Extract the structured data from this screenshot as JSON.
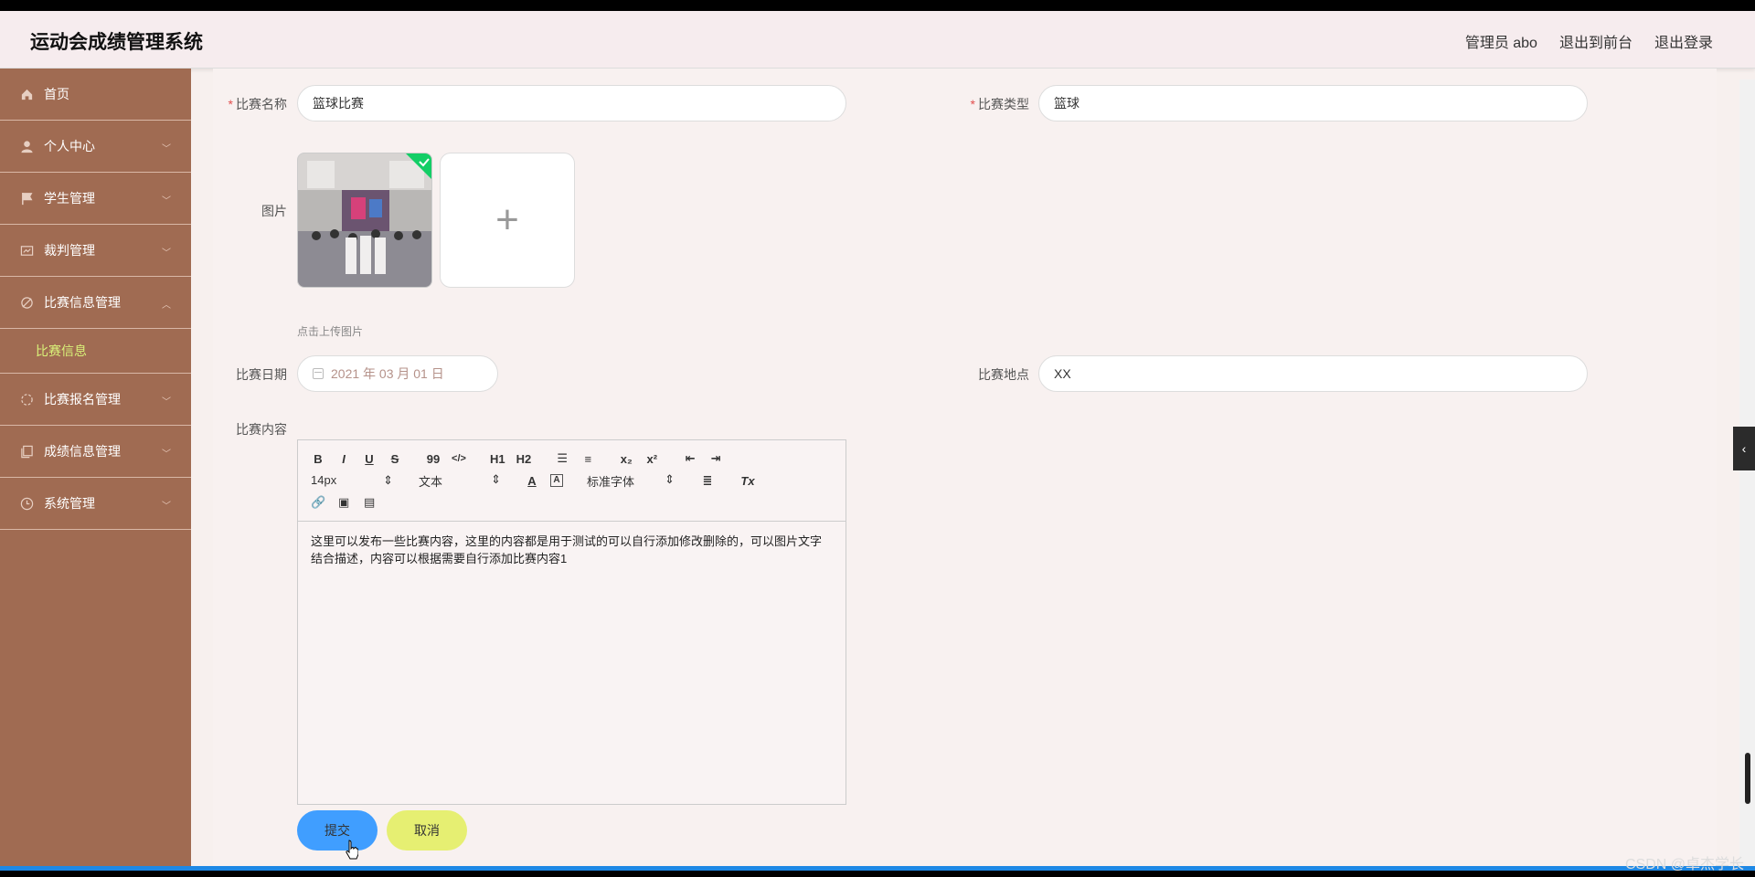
{
  "header": {
    "title": "运动会成绩管理系统",
    "admin": "管理员 abo",
    "exit_front": "退出到前台",
    "logout": "退出登录"
  },
  "sidebar": {
    "items": [
      {
        "label": "首页",
        "icon": "home-icon",
        "expandable": false
      },
      {
        "label": "个人中心",
        "icon": "user-icon",
        "expandable": true
      },
      {
        "label": "学生管理",
        "icon": "flag-icon",
        "expandable": true
      },
      {
        "label": "裁判管理",
        "icon": "board-icon",
        "expandable": true
      },
      {
        "label": "比赛信息管理",
        "icon": "tag-icon",
        "expandable": true,
        "expanded": true
      },
      {
        "label": "比赛报名管理",
        "icon": "circle-icon",
        "expandable": true
      },
      {
        "label": "成绩信息管理",
        "icon": "copy-icon",
        "expandable": true
      },
      {
        "label": "系统管理",
        "icon": "clock-icon",
        "expandable": true
      }
    ],
    "sub_active": "比赛信息"
  },
  "form": {
    "name_label": "比赛名称",
    "name_value": "篮球比赛",
    "type_label": "比赛类型",
    "type_value": "篮球",
    "image_label": "图片",
    "image_tip": "点击上传图片",
    "date_label": "比赛日期",
    "date_value": "2021 年 03 月 01 日",
    "place_label": "比赛地点",
    "place_value": "XX",
    "content_label": "比赛内容",
    "content_text": "这里可以发布一些比赛内容，这里的内容都是用于测试的可以自行添加修改删除的，可以图片文字结合描述，内容可以根据需要自行添加比赛内容1",
    "submit": "提交",
    "cancel": "取消"
  },
  "toolbar": {
    "bold": "B",
    "italic": "I",
    "underline": "U",
    "strike": "S",
    "quote": "99",
    "code": "</>",
    "h1": "H1",
    "h2": "H2",
    "sub": "x₂",
    "sup": "x²",
    "size": "14px",
    "header_select": "文本",
    "font_select": "标准字体",
    "clean": "Tx"
  },
  "colors": {
    "sidebar": "#a06b52",
    "active_sub": "#d9f279",
    "submit": "#409eff",
    "cancel": "#e6ef72"
  },
  "watermark": "CSDN @卓杰学长"
}
